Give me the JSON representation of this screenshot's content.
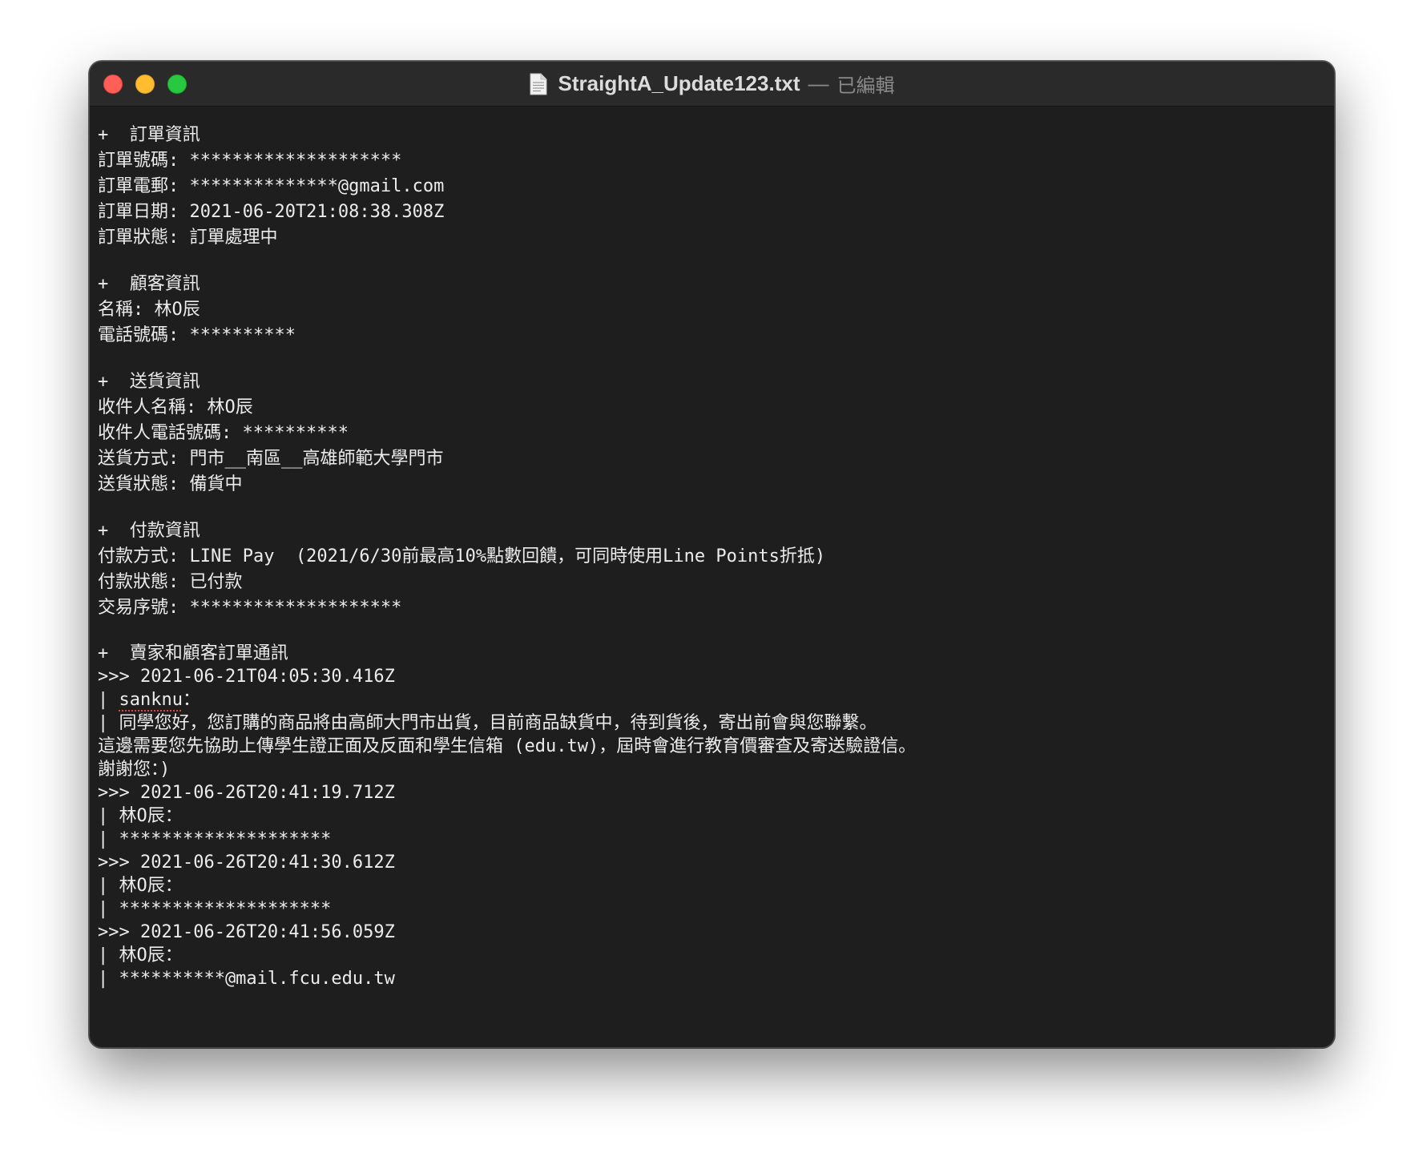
{
  "window": {
    "file_name": "StraightA_Update123.txt",
    "separator": "—",
    "status": "已編輯"
  },
  "document": {
    "order": {
      "heading": "+  訂單資訊",
      "lines": [
        "訂單號碼: ********************",
        "訂單電郵: **************@gmail.com",
        "訂單日期: 2021-06-20T21:08:38.308Z",
        "訂單狀態: 訂單處理中"
      ]
    },
    "customer": {
      "heading": "+  顧客資訊",
      "lines": [
        "名稱: 林O辰",
        "電話號碼: **********"
      ]
    },
    "delivery": {
      "heading": "+  送貨資訊",
      "lines": [
        "收件人名稱: 林O辰",
        "收件人電話號碼: **********",
        "送貨方式: 門市__南區__高雄師範大學門市",
        "送貨狀態: 備貨中"
      ]
    },
    "payment": {
      "heading": "+  付款資訊",
      "lines": [
        "付款方式: LINE Pay  (2021/6/30前最高10%點數回饋，可同時使用Line Points折抵)",
        "付款狀態: 已付款",
        "交易序號: ********************"
      ]
    },
    "messages": {
      "heading": "+  賣家和顧客訂單通訊",
      "m1_time": ">>> 2021-06-21T04:05:30.416Z",
      "m1_prefix": "| ",
      "m1_sender": "sanknu",
      "m1_colon": "：",
      "m1_body": [
        "| 同學您好，您訂購的商品將由高師大門市出貨，目前商品缺貨中，待到貨後，寄出前會與您聯繫。",
        "這邊需要您先協助上傳學生證正面及反面和學生信箱 (edu.tw)，屆時會進行教育價審查及寄送驗證信。",
        "謝謝您：)"
      ],
      "m2": [
        ">>> 2021-06-26T20:41:19.712Z",
        "| 林O辰：",
        "| ********************"
      ],
      "m3": [
        ">>> 2021-06-26T20:41:30.612Z",
        "| 林O辰：",
        "| ********************"
      ],
      "m4": [
        ">>> 2021-06-26T20:41:56.059Z",
        "| 林O辰：",
        "| **********@mail.fcu.edu.tw"
      ]
    }
  }
}
